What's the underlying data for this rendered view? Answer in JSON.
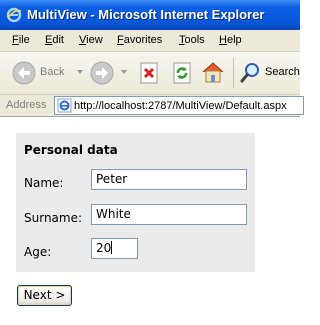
{
  "window": {
    "title": "MultiView - Microsoft Internet Explorer"
  },
  "menu": [
    "File",
    "Edit",
    "View",
    "Favorites",
    "Tools",
    "Help"
  ],
  "toolbar": {
    "back_label": "Back",
    "search_label": "Search"
  },
  "address": {
    "label": "Address",
    "url": "http://localhost:2787/MultiView/Default.aspx"
  },
  "form": {
    "title": "Personal data",
    "name_label": "Name:",
    "name_value": "Peter",
    "surname_label": "Surname:",
    "surname_value": "White",
    "age_label": "Age:",
    "age_value": "20"
  },
  "next_button": "Next >"
}
